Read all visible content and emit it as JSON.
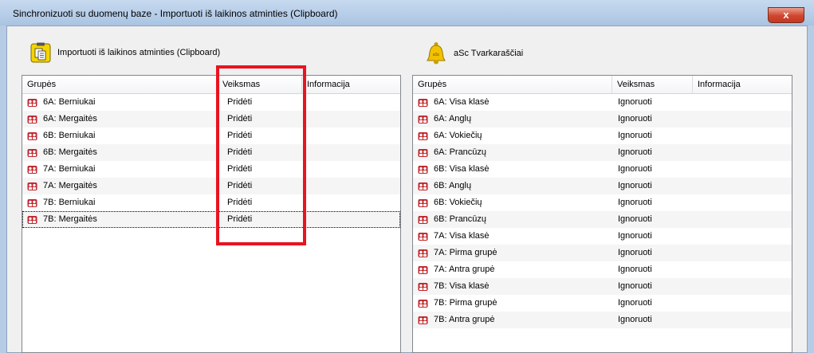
{
  "window": {
    "title": "Sinchronizuoti su duomenų baze - Importuoti iš laikinos atminties (Clipboard)",
    "close_label": "x"
  },
  "left": {
    "header_label": "Importuoti iš laikinos atminties (Clipboard)",
    "columns": [
      "Grupės",
      "Veiksmas",
      "Informacija"
    ],
    "rows": [
      {
        "name": "6A: Berniukai",
        "action": "Pridėti"
      },
      {
        "name": "6A: Mergaitės",
        "action": "Pridėti"
      },
      {
        "name": "6B: Berniukai",
        "action": "Pridėti"
      },
      {
        "name": "6B: Mergaitės",
        "action": "Pridėti"
      },
      {
        "name": "7A: Berniukai",
        "action": "Pridėti"
      },
      {
        "name": "7A: Mergaitės",
        "action": "Pridėti"
      },
      {
        "name": "7B: Berniukai",
        "action": "Pridėti"
      },
      {
        "name": "7B: Mergaitės",
        "action": "Pridėti"
      }
    ]
  },
  "right": {
    "header_label": "aSc Tvarkaraščiai",
    "columns": [
      "Grupės",
      "Veiksmas",
      "Informacija"
    ],
    "rows": [
      {
        "name": "6A: Visa klasė",
        "action": "Ignoruoti"
      },
      {
        "name": "6A: Anglų",
        "action": "Ignoruoti"
      },
      {
        "name": "6A: Vokiečių",
        "action": "Ignoruoti"
      },
      {
        "name": "6A: Prancūzų",
        "action": "Ignoruoti"
      },
      {
        "name": "6B: Visa klasė",
        "action": "Ignoruoti"
      },
      {
        "name": "6B: Anglų",
        "action": "Ignoruoti"
      },
      {
        "name": "6B: Vokiečių",
        "action": "Ignoruoti"
      },
      {
        "name": "6B: Prancūzų",
        "action": "Ignoruoti"
      },
      {
        "name": "7A: Visa klasė",
        "action": "Ignoruoti"
      },
      {
        "name": "7A: Pirma grupė",
        "action": "Ignoruoti"
      },
      {
        "name": "7A: Antra grupė",
        "action": "Ignoruoti"
      },
      {
        "name": "7B: Visa klasė",
        "action": "Ignoruoti"
      },
      {
        "name": "7B: Pirma grupė",
        "action": "Ignoruoti"
      },
      {
        "name": "7B: Antra grupė",
        "action": "Ignoruoti"
      }
    ]
  },
  "colors": {
    "highlight_box": "#e8141f",
    "group_icon": "#c0262c"
  }
}
